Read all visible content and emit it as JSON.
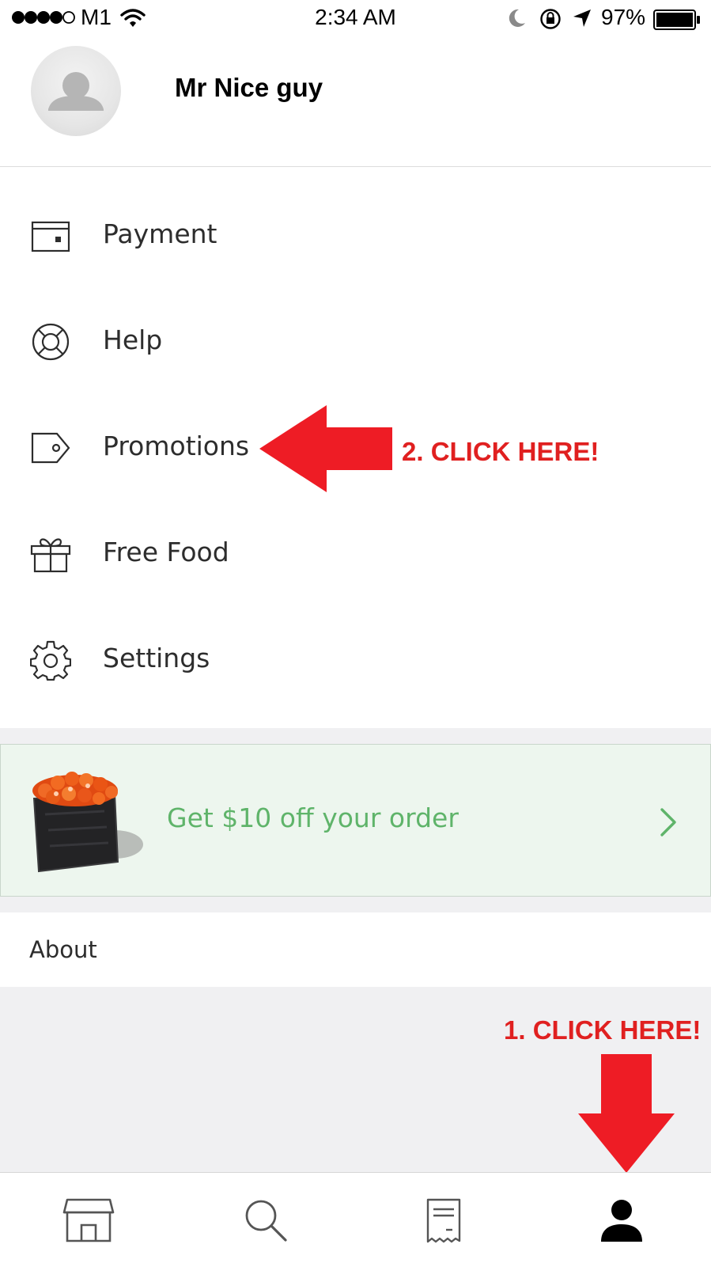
{
  "status_bar": {
    "carrier": "M1",
    "time": "2:34 AM",
    "battery": "97%"
  },
  "profile": {
    "name": "Mr Nice guy",
    "avatar_icon": "user-placeholder-icon"
  },
  "menu": {
    "items": [
      {
        "label": "Payment",
        "icon": "wallet-icon"
      },
      {
        "label": "Help",
        "icon": "lifebuoy-icon"
      },
      {
        "label": "Promotions",
        "icon": "tag-icon"
      },
      {
        "label": "Free Food",
        "icon": "gift-icon"
      },
      {
        "label": "Settings",
        "icon": "gear-icon"
      }
    ]
  },
  "annotations": {
    "step1": "1. CLICK HERE!",
    "step2": "2. CLICK HERE!",
    "color": "#e02020"
  },
  "promo": {
    "text": "Get $10 off your order",
    "text_color": "#5fb46a",
    "background": "#edf6ee"
  },
  "about": {
    "label": "About"
  },
  "tab_bar": {
    "tabs": [
      {
        "icon": "store-icon"
      },
      {
        "icon": "search-icon"
      },
      {
        "icon": "receipt-icon"
      },
      {
        "icon": "account-icon",
        "active": true
      }
    ]
  }
}
